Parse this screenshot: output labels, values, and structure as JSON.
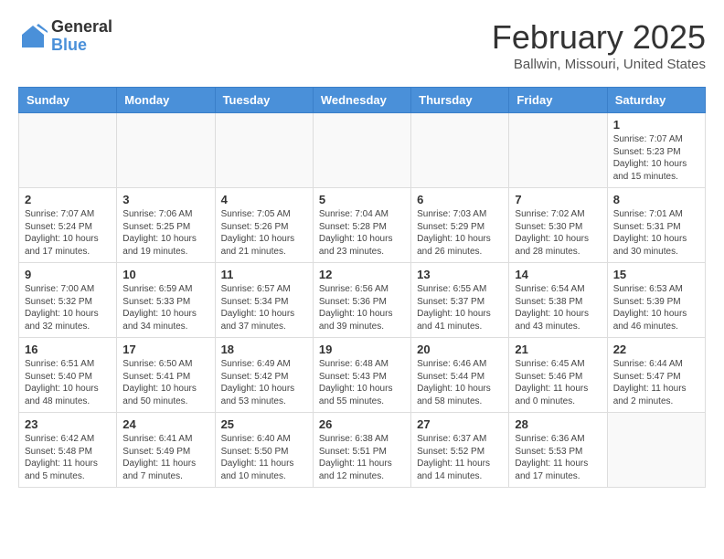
{
  "header": {
    "logo_general": "General",
    "logo_blue": "Blue",
    "month_year": "February 2025",
    "location": "Ballwin, Missouri, United States"
  },
  "weekdays": [
    "Sunday",
    "Monday",
    "Tuesday",
    "Wednesday",
    "Thursday",
    "Friday",
    "Saturday"
  ],
  "weeks": [
    [
      {
        "day": "",
        "info": ""
      },
      {
        "day": "",
        "info": ""
      },
      {
        "day": "",
        "info": ""
      },
      {
        "day": "",
        "info": ""
      },
      {
        "day": "",
        "info": ""
      },
      {
        "day": "",
        "info": ""
      },
      {
        "day": "1",
        "info": "Sunrise: 7:07 AM\nSunset: 5:23 PM\nDaylight: 10 hours\nand 15 minutes."
      }
    ],
    [
      {
        "day": "2",
        "info": "Sunrise: 7:07 AM\nSunset: 5:24 PM\nDaylight: 10 hours\nand 17 minutes."
      },
      {
        "day": "3",
        "info": "Sunrise: 7:06 AM\nSunset: 5:25 PM\nDaylight: 10 hours\nand 19 minutes."
      },
      {
        "day": "4",
        "info": "Sunrise: 7:05 AM\nSunset: 5:26 PM\nDaylight: 10 hours\nand 21 minutes."
      },
      {
        "day": "5",
        "info": "Sunrise: 7:04 AM\nSunset: 5:28 PM\nDaylight: 10 hours\nand 23 minutes."
      },
      {
        "day": "6",
        "info": "Sunrise: 7:03 AM\nSunset: 5:29 PM\nDaylight: 10 hours\nand 26 minutes."
      },
      {
        "day": "7",
        "info": "Sunrise: 7:02 AM\nSunset: 5:30 PM\nDaylight: 10 hours\nand 28 minutes."
      },
      {
        "day": "8",
        "info": "Sunrise: 7:01 AM\nSunset: 5:31 PM\nDaylight: 10 hours\nand 30 minutes."
      }
    ],
    [
      {
        "day": "9",
        "info": "Sunrise: 7:00 AM\nSunset: 5:32 PM\nDaylight: 10 hours\nand 32 minutes."
      },
      {
        "day": "10",
        "info": "Sunrise: 6:59 AM\nSunset: 5:33 PM\nDaylight: 10 hours\nand 34 minutes."
      },
      {
        "day": "11",
        "info": "Sunrise: 6:57 AM\nSunset: 5:34 PM\nDaylight: 10 hours\nand 37 minutes."
      },
      {
        "day": "12",
        "info": "Sunrise: 6:56 AM\nSunset: 5:36 PM\nDaylight: 10 hours\nand 39 minutes."
      },
      {
        "day": "13",
        "info": "Sunrise: 6:55 AM\nSunset: 5:37 PM\nDaylight: 10 hours\nand 41 minutes."
      },
      {
        "day": "14",
        "info": "Sunrise: 6:54 AM\nSunset: 5:38 PM\nDaylight: 10 hours\nand 43 minutes."
      },
      {
        "day": "15",
        "info": "Sunrise: 6:53 AM\nSunset: 5:39 PM\nDaylight: 10 hours\nand 46 minutes."
      }
    ],
    [
      {
        "day": "16",
        "info": "Sunrise: 6:51 AM\nSunset: 5:40 PM\nDaylight: 10 hours\nand 48 minutes."
      },
      {
        "day": "17",
        "info": "Sunrise: 6:50 AM\nSunset: 5:41 PM\nDaylight: 10 hours\nand 50 minutes."
      },
      {
        "day": "18",
        "info": "Sunrise: 6:49 AM\nSunset: 5:42 PM\nDaylight: 10 hours\nand 53 minutes."
      },
      {
        "day": "19",
        "info": "Sunrise: 6:48 AM\nSunset: 5:43 PM\nDaylight: 10 hours\nand 55 minutes."
      },
      {
        "day": "20",
        "info": "Sunrise: 6:46 AM\nSunset: 5:44 PM\nDaylight: 10 hours\nand 58 minutes."
      },
      {
        "day": "21",
        "info": "Sunrise: 6:45 AM\nSunset: 5:46 PM\nDaylight: 11 hours\nand 0 minutes."
      },
      {
        "day": "22",
        "info": "Sunrise: 6:44 AM\nSunset: 5:47 PM\nDaylight: 11 hours\nand 2 minutes."
      }
    ],
    [
      {
        "day": "23",
        "info": "Sunrise: 6:42 AM\nSunset: 5:48 PM\nDaylight: 11 hours\nand 5 minutes."
      },
      {
        "day": "24",
        "info": "Sunrise: 6:41 AM\nSunset: 5:49 PM\nDaylight: 11 hours\nand 7 minutes."
      },
      {
        "day": "25",
        "info": "Sunrise: 6:40 AM\nSunset: 5:50 PM\nDaylight: 11 hours\nand 10 minutes."
      },
      {
        "day": "26",
        "info": "Sunrise: 6:38 AM\nSunset: 5:51 PM\nDaylight: 11 hours\nand 12 minutes."
      },
      {
        "day": "27",
        "info": "Sunrise: 6:37 AM\nSunset: 5:52 PM\nDaylight: 11 hours\nand 14 minutes."
      },
      {
        "day": "28",
        "info": "Sunrise: 6:36 AM\nSunset: 5:53 PM\nDaylight: 11 hours\nand 17 minutes."
      },
      {
        "day": "",
        "info": ""
      }
    ]
  ]
}
